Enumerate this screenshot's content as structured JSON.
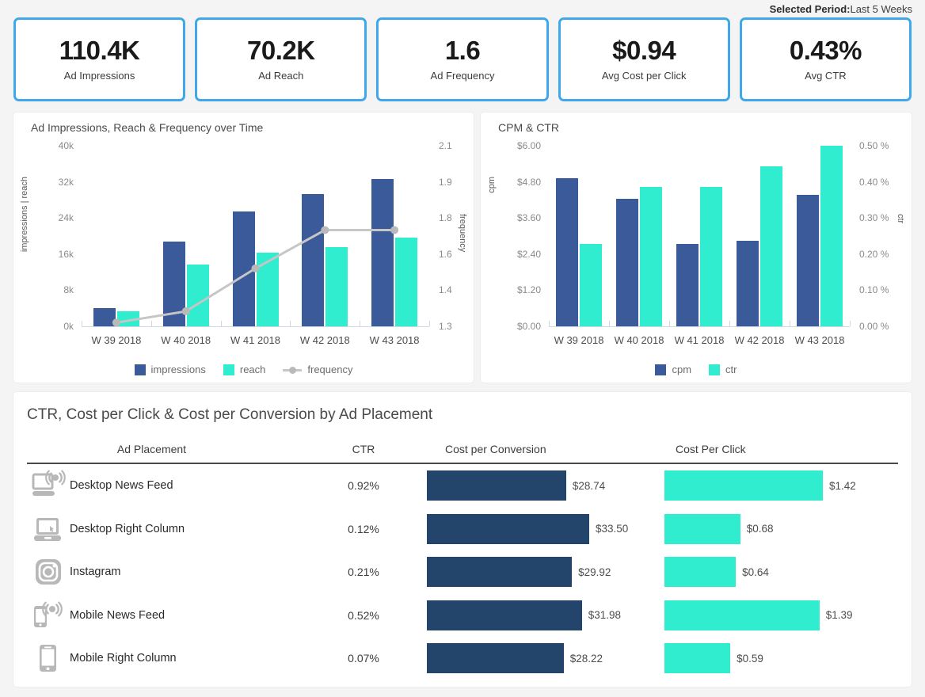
{
  "header": {
    "period_label": "Selected Period:",
    "period_value": "Last 5 Weeks"
  },
  "kpis": [
    {
      "value": "110.4K",
      "label": "Ad Impressions"
    },
    {
      "value": "70.2K",
      "label": "Ad Reach"
    },
    {
      "value": "1.6",
      "label": "Ad Frequency"
    },
    {
      "value": "$0.94",
      "label": "Avg Cost per Click"
    },
    {
      "value": "0.43%",
      "label": "Avg CTR"
    }
  ],
  "colors": {
    "card_border": "#3fa7ec",
    "navy": "#3b5a9a",
    "teal": "#2fedce",
    "table_dark": "#23456b",
    "line_gray": "#c6c6c6",
    "page_bg": "#f4f4f4"
  },
  "chart_data": [
    {
      "type": "bar",
      "id": "impressions-reach-frequency",
      "title": "Ad Impressions, Reach & Frequency over Time",
      "categories": [
        "W 39 2018",
        "W 40 2018",
        "W 41 2018",
        "W 42 2018",
        "W 43 2018"
      ],
      "ylabel": "impressions | reach",
      "y2label": "frequency",
      "ylim": [
        0,
        40000
      ],
      "yticks": [
        "0k",
        "8k",
        "16k",
        "24k",
        "32k",
        "40k"
      ],
      "y2lim": [
        1.3,
        2.1
      ],
      "y2ticks": [
        "1.3",
        "1.4",
        "1.6",
        "1.8",
        "1.9",
        "2.1"
      ],
      "grid": false,
      "legend_position": "bottom",
      "series": [
        {
          "name": "impressions",
          "kind": "bar",
          "color": "#3b5a9a",
          "values": [
            4100,
            18700,
            25400,
            29300,
            32600
          ]
        },
        {
          "name": "reach",
          "kind": "bar",
          "color": "#2fedce",
          "values": [
            3300,
            13700,
            16400,
            17500,
            19700
          ]
        },
        {
          "name": "frequency",
          "kind": "line",
          "color": "#c6c6c6",
          "values": [
            1.32,
            1.37,
            1.56,
            1.73,
            1.73
          ]
        }
      ]
    },
    {
      "type": "bar",
      "id": "cpm-ctr",
      "title": "CPM & CTR",
      "categories": [
        "W 39 2018",
        "W 40 2018",
        "W 41 2018",
        "W 42 2018",
        "W 43 2018"
      ],
      "ylabel": "cpm",
      "y2label": "ctr",
      "ylim": [
        0,
        6.0
      ],
      "yticks": [
        "$0.00",
        "$1.20",
        "$2.40",
        "$3.60",
        "$4.80",
        "$6.00"
      ],
      "y2lim": [
        0,
        0.5
      ],
      "y2ticks": [
        "0.00 %",
        "0.10 %",
        "0.20 %",
        "0.30 %",
        "0.40 %",
        "0.50 %"
      ],
      "grid": false,
      "legend_position": "bottom",
      "series": [
        {
          "name": "cpm",
          "kind": "bar",
          "color": "#3b5a9a",
          "values": [
            4.92,
            4.25,
            2.75,
            2.85,
            4.38
          ]
        },
        {
          "name": "ctr",
          "kind": "bar",
          "color": "#2fedce",
          "values": [
            0.228,
            0.385,
            0.385,
            0.443,
            0.5
          ]
        }
      ]
    }
  ],
  "table": {
    "title": "CTR, Cost per Click & Cost per Conversion by Ad Placement",
    "columns": [
      "Ad Placement",
      "CTR",
      "Cost per Conversion",
      "Cost Per Click"
    ],
    "cpconv_max": 33.5,
    "cpc_max": 1.42,
    "rows": [
      {
        "icon": "laptop-broadcast-icon",
        "placement": "Desktop News Feed",
        "ctr": "0.92%",
        "cost_per_conversion": "$28.74",
        "cost_per_conversion_value": 28.74,
        "cost_per_click": "$1.42",
        "cost_per_click_value": 1.42
      },
      {
        "icon": "laptop-icon",
        "placement": "Desktop Right Column",
        "ctr": "0.12%",
        "cost_per_conversion": "$33.50",
        "cost_per_conversion_value": 33.5,
        "cost_per_click": "$0.68",
        "cost_per_click_value": 0.68
      },
      {
        "icon": "instagram-icon",
        "placement": "Instagram",
        "ctr": "0.21%",
        "cost_per_conversion": "$29.92",
        "cost_per_conversion_value": 29.92,
        "cost_per_click": "$0.64",
        "cost_per_click_value": 0.64
      },
      {
        "icon": "mobile-broadcast-icon",
        "placement": "Mobile News Feed",
        "ctr": "0.52%",
        "cost_per_conversion": "$31.98",
        "cost_per_conversion_value": 31.98,
        "cost_per_click": "$1.39",
        "cost_per_click_value": 1.39
      },
      {
        "icon": "mobile-icon",
        "placement": "Mobile Right Column",
        "ctr": "0.07%",
        "cost_per_conversion": "$28.22",
        "cost_per_conversion_value": 28.22,
        "cost_per_click": "$0.59",
        "cost_per_click_value": 0.59
      }
    ]
  }
}
